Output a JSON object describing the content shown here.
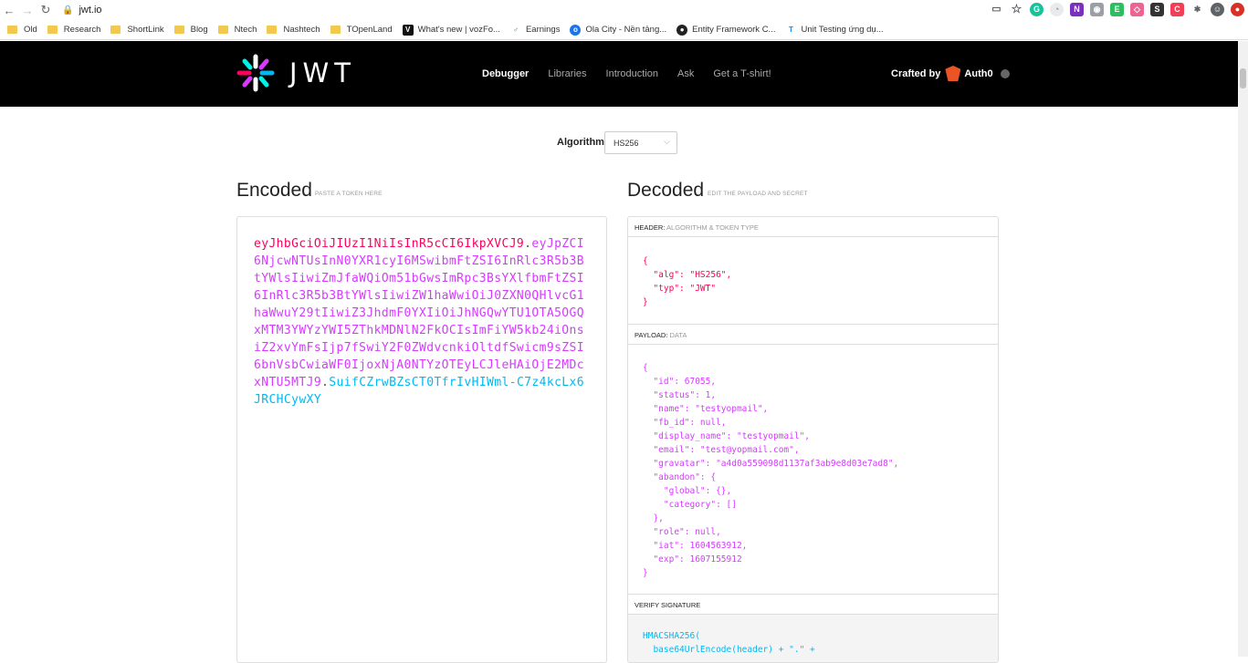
{
  "browser": {
    "url": "jwt.io",
    "bookmarks": [
      {
        "label": "Old",
        "kind": "folder"
      },
      {
        "label": "Research",
        "kind": "folder"
      },
      {
        "label": "ShortLink",
        "kind": "folder"
      },
      {
        "label": "Blog",
        "kind": "folder"
      },
      {
        "label": "Ntech",
        "kind": "folder"
      },
      {
        "label": "Nashtech",
        "kind": "folder"
      },
      {
        "label": "TOpenLand",
        "kind": "folder"
      },
      {
        "label": "What's new | vozFo...",
        "kind": "site"
      },
      {
        "label": "Earnings",
        "kind": "site"
      },
      {
        "label": "Ola City - Nền tảng...",
        "kind": "site"
      },
      {
        "label": "Entity Framework C...",
        "kind": "site"
      },
      {
        "label": "Unit Testing ứng dụ...",
        "kind": "site"
      }
    ]
  },
  "nav": {
    "logo_text": "JWT",
    "links": [
      "Debugger",
      "Libraries",
      "Introduction",
      "Ask",
      "Get a T-shirt!"
    ],
    "crafted_by": "Crafted by",
    "brand": "Auth0"
  },
  "algorithm": {
    "label": "Algorithm",
    "selected": "HS256"
  },
  "encoded": {
    "title": "Encoded",
    "subtitle": "PASTE A TOKEN HERE",
    "header_part": "eyJhbGciOiJIUzI1NiIsInR5cCI6IkpXVCJ9",
    "payload_part": "eyJpZCI6NjcwNTUsInN0YXR1cyI6MSwibmFtZSI6InRlc3R5b3BtYWlsIiwiZmJfaWQiOm51bGwsImRpc3BsYXlfbmFtZSI6InRlc3R5b3BtYWlsIiwiZW1haWwiOiJ0ZXN0QHlvcG1haWwuY29tIiwiZ3JhdmF0YXIiOiJhNGQwYTU1OTA5OGQxMTM3YWYzYWI5ZThkMDNlN2FkOCIsImFiYW5kb24iOnsiZ2xvYmFsIjp7fSwiY2F0ZWdvcnkiOltdfSwicm9sZSI6bnVsbCwiaWF0IjoxNjA0NTYzOTEyLCJleHAiOjE2MDcxNTU5MTJ9",
    "signature_part": "SuifCZrwBZsCT0TfrIvHIWml-C7z4kcLx6JRCHCywXY",
    "dot": "."
  },
  "decoded": {
    "title": "Decoded",
    "subtitle": "EDIT THE PAYLOAD AND SECRET",
    "header_label": "HEADER:",
    "header_sub": "ALGORITHM & TOKEN TYPE",
    "header_json": "{\n  \"alg\": \"HS256\",\n  \"typ\": \"JWT\"\n}",
    "payload_label": "PAYLOAD:",
    "payload_sub": "DATA",
    "payload_json": "{\n  \"id\": 67055,\n  \"status\": 1,\n  \"name\": \"testyopmail\",\n  \"fb_id\": null,\n  \"display_name\": \"testyopmail\",\n  \"email\": \"test@yopmail.com\",\n  \"gravatar\": \"a4d0a559098d1137af3ab9e8d03e7ad8\",\n  \"abandon\": {\n    \"global\": {},\n    \"category\": []\n  },\n  \"role\": null,\n  \"iat\": 1604563912,\n  \"exp\": 1607155912\n}",
    "verify_label": "VERIFY SIGNATURE",
    "verify_code": "HMACSHA256(\n  base64UrlEncode(header) + \".\" +"
  }
}
